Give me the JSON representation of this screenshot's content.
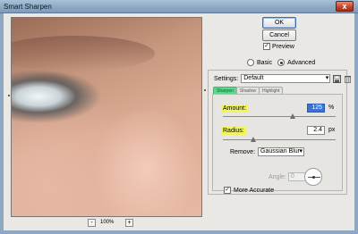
{
  "window": {
    "title": "Smart Sharpen",
    "close_glyph": "x"
  },
  "preview": {
    "zoom_out_glyph": "-",
    "zoom_in_glyph": "+",
    "zoom_value": "100%"
  },
  "buttons": {
    "ok_label": "OK",
    "cancel_label": "Cancel"
  },
  "preview_toggle": {
    "label": "Preview",
    "checked": true
  },
  "mode": {
    "basic_label": "Basic",
    "advanced_label": "Advanced",
    "selected": "Advanced"
  },
  "settings": {
    "label": "Settings:",
    "value": "Default",
    "save_icon": "save-icon",
    "delete_icon": "trash-icon"
  },
  "tabs": [
    {
      "label": "Sharpen",
      "active": true
    },
    {
      "label": "Shadow",
      "active": false
    },
    {
      "label": "Highlight",
      "active": false
    }
  ],
  "amount": {
    "label": "Amount:",
    "value": "125",
    "unit": "%",
    "slider_fraction": 0.62
  },
  "radius": {
    "label": "Radius:",
    "value": "2.4",
    "unit": "px",
    "slider_fraction": 0.27
  },
  "remove": {
    "label": "Remove:",
    "value": "Gaussian Blur"
  },
  "angle": {
    "label": "Angle:",
    "value": "0",
    "enabled": false
  },
  "more_accurate": {
    "label": "More Accurate",
    "checked": true
  },
  "colors": {
    "highlight": "#f2f55a",
    "active_tab": "#5dd88a",
    "selected_field": "#3a73d8"
  }
}
